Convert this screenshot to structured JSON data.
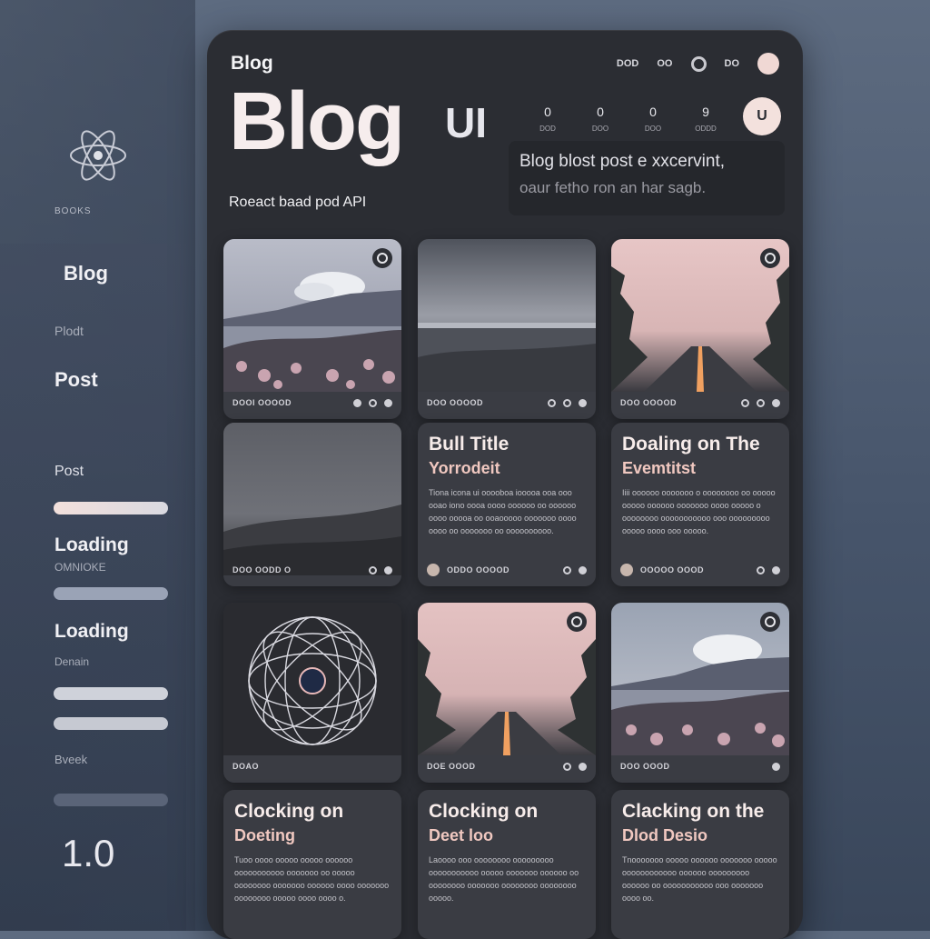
{
  "sidebar": {
    "logo_caption": "BOOKS",
    "items": [
      {
        "label": "Blog"
      },
      {
        "label": "Plodt"
      },
      {
        "label": "Post"
      },
      {
        "label": "Post"
      },
      {
        "label": "Loading",
        "sub": "OMNIOKE"
      },
      {
        "label": "Loading",
        "sub": "Denain"
      },
      {
        "label": "Bveek"
      }
    ],
    "version": "1.0"
  },
  "header": {
    "brand_small": "Blog",
    "brand_big": "Blog",
    "brand_suffix": "UI",
    "tagline": "Roeact baad pod API",
    "top_icons": [
      "DOD",
      "OO",
      "DO"
    ],
    "stats": [
      {
        "value": "0",
        "label": "DOD"
      },
      {
        "value": "0",
        "label": "DOO"
      },
      {
        "value": "0",
        "label": "DOO"
      },
      {
        "value": "9",
        "label": "ODDD"
      }
    ],
    "avatar_initial": "U",
    "excerpt_line1": "Blog blost post e xxcervint,",
    "excerpt_line2": "oaur fetho ron an har sagb."
  },
  "cards": [
    {
      "type": "image",
      "meta": "DOOI OOOOD"
    },
    {
      "type": "image",
      "meta": "DOO OOOOD"
    },
    {
      "type": "image",
      "meta": "DOO OOOOD"
    },
    {
      "type": "image",
      "meta": "DOO OODD O"
    },
    {
      "type": "text",
      "title": "Bull Title",
      "subtitle": "Yorrodeit",
      "body": "Tiona icona ui ooooboa iooooa ooa ooo ooao iono oooa oooo oooooo oo oooooo oooo ooooa oo ooaooooo ooooooo oooo oooo oo ooooooo oo oooooooooo.",
      "meta": "ODDO OOOOD"
    },
    {
      "type": "text",
      "title": "Doaling on The",
      "subtitle": "Evemtitst",
      "body": "Iiii oooooo ooooooo o oooooooo oo ooooo ooooo oooooo ooooooo oooo ooooo o oooooooo ooooooooooo ooo ooooooooo ooooo oooo ooo ooooo.",
      "meta": "OOOOO OOOD"
    },
    {
      "type": "image",
      "meta": "DOAO"
    },
    {
      "type": "image",
      "meta": "DOE OOOD"
    },
    {
      "type": "image",
      "meta": "DOO OOOD"
    },
    {
      "type": "text",
      "title": "Clocking on",
      "subtitle": "Doeting",
      "body": "Tuoo oooo ooooo ooooo oooooo ooooooooooo ooooooo oo ooooo oooooooo ooooooo oooooo oooo ooooooo oooooooo ooooo oooo oooo o.",
      "meta": ""
    },
    {
      "type": "text",
      "title": "Clocking on",
      "subtitle": "Deet loo",
      "body": "Laoooo ooo oooooooo ooooooooo ooooooooooo ooooo ooooooo oooooo oo oooooooo ooooooo oooooooo oooooooo ooooo.",
      "meta": ""
    },
    {
      "type": "text",
      "title": "Clacking on the",
      "subtitle": "Dlod Desio",
      "body": "Tnooooooo ooooo oooooo ooooooo ooooo oooooooooooo oooooo ooooooooo oooooo oo ooooooooooo ooo ooooooo oooo oo.",
      "meta": ""
    }
  ],
  "colors": {
    "background": "#4b596e",
    "panel": "#2b2d33",
    "card": "#3a3c43",
    "accent_pink": "#f0c8c0"
  }
}
